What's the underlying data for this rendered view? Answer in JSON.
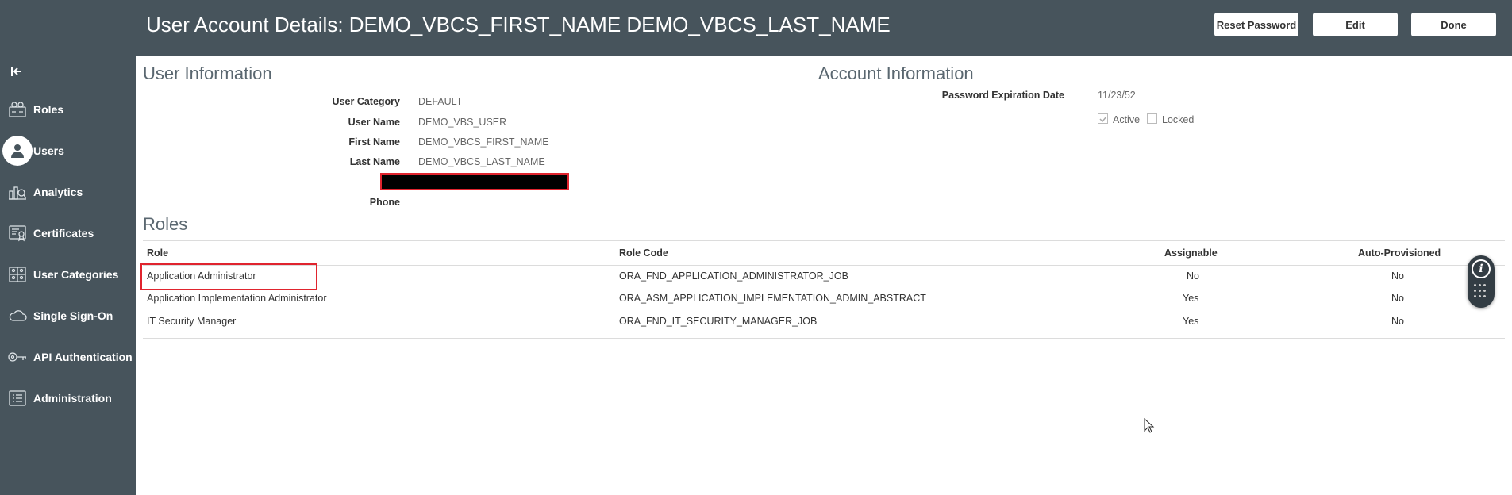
{
  "header": {
    "title": "User Account Details: DEMO_VBCS_FIRST_NAME DEMO_VBCS_LAST_NAME",
    "buttons": {
      "reset_password": "Reset Password",
      "edit": "Edit",
      "done": "Done"
    },
    "background": "#47545c"
  },
  "sidebar": {
    "collapse_icon": "collapse-left-icon",
    "items": [
      {
        "label": "Roles",
        "icon": "roles-icon",
        "active": false
      },
      {
        "label": "Users",
        "icon": "user-icon",
        "active": true
      },
      {
        "label": "Analytics",
        "icon": "analytics-icon",
        "active": false
      },
      {
        "label": "Certificates",
        "icon": "certificate-icon",
        "active": false
      },
      {
        "label": "User Categories",
        "icon": "user-categories-icon",
        "active": false
      },
      {
        "label": "Single Sign-On",
        "icon": "cloud-icon",
        "active": false
      },
      {
        "label": "API Authentication",
        "icon": "key-icon",
        "active": false
      },
      {
        "label": "Administration",
        "icon": "administration-icon",
        "active": false
      }
    ]
  },
  "user_information": {
    "title": "User Information",
    "fields": [
      {
        "label": "User Category",
        "value": "DEFAULT"
      },
      {
        "label": "User Name",
        "value": "DEMO_VBS_USER"
      },
      {
        "label": "First Name",
        "value": "DEMO_VBCS_FIRST_NAME"
      },
      {
        "label": "Last Name",
        "value": "DEMO_VBCS_LAST_NAME"
      },
      {
        "label": "Phone",
        "value": ""
      }
    ]
  },
  "account_information": {
    "title": "Account Information",
    "password_expiration_label": "Password Expiration Date",
    "password_expiration_value": "11/23/52",
    "active_label": "Active",
    "active_checked": true,
    "locked_label": "Locked",
    "locked_checked": false
  },
  "roles": {
    "title": "Roles",
    "columns": [
      "Role",
      "Role Code",
      "Assignable",
      "Auto-Provisioned"
    ],
    "rows": [
      {
        "role": "Application Administrator",
        "code": "ORA_FND_APPLICATION_ADMINISTRATOR_JOB",
        "assignable": "No",
        "auto": "No"
      },
      {
        "role": "Application Implementation Administrator",
        "code": "ORA_ASM_APPLICATION_IMPLEMENTATION_ADMIN_ABSTRACT",
        "assignable": "Yes",
        "auto": "No"
      },
      {
        "role": "IT Security Manager",
        "code": "ORA_FND_IT_SECURITY_MANAGER_JOB",
        "assignable": "Yes",
        "auto": "No"
      }
    ]
  },
  "widget": {
    "info_icon": "info-icon",
    "grid_icon": "grid-dots-icon",
    "info_glyph": "i"
  },
  "colors": {
    "highlight": "#e0242e",
    "sidebar": "#47545c"
  }
}
